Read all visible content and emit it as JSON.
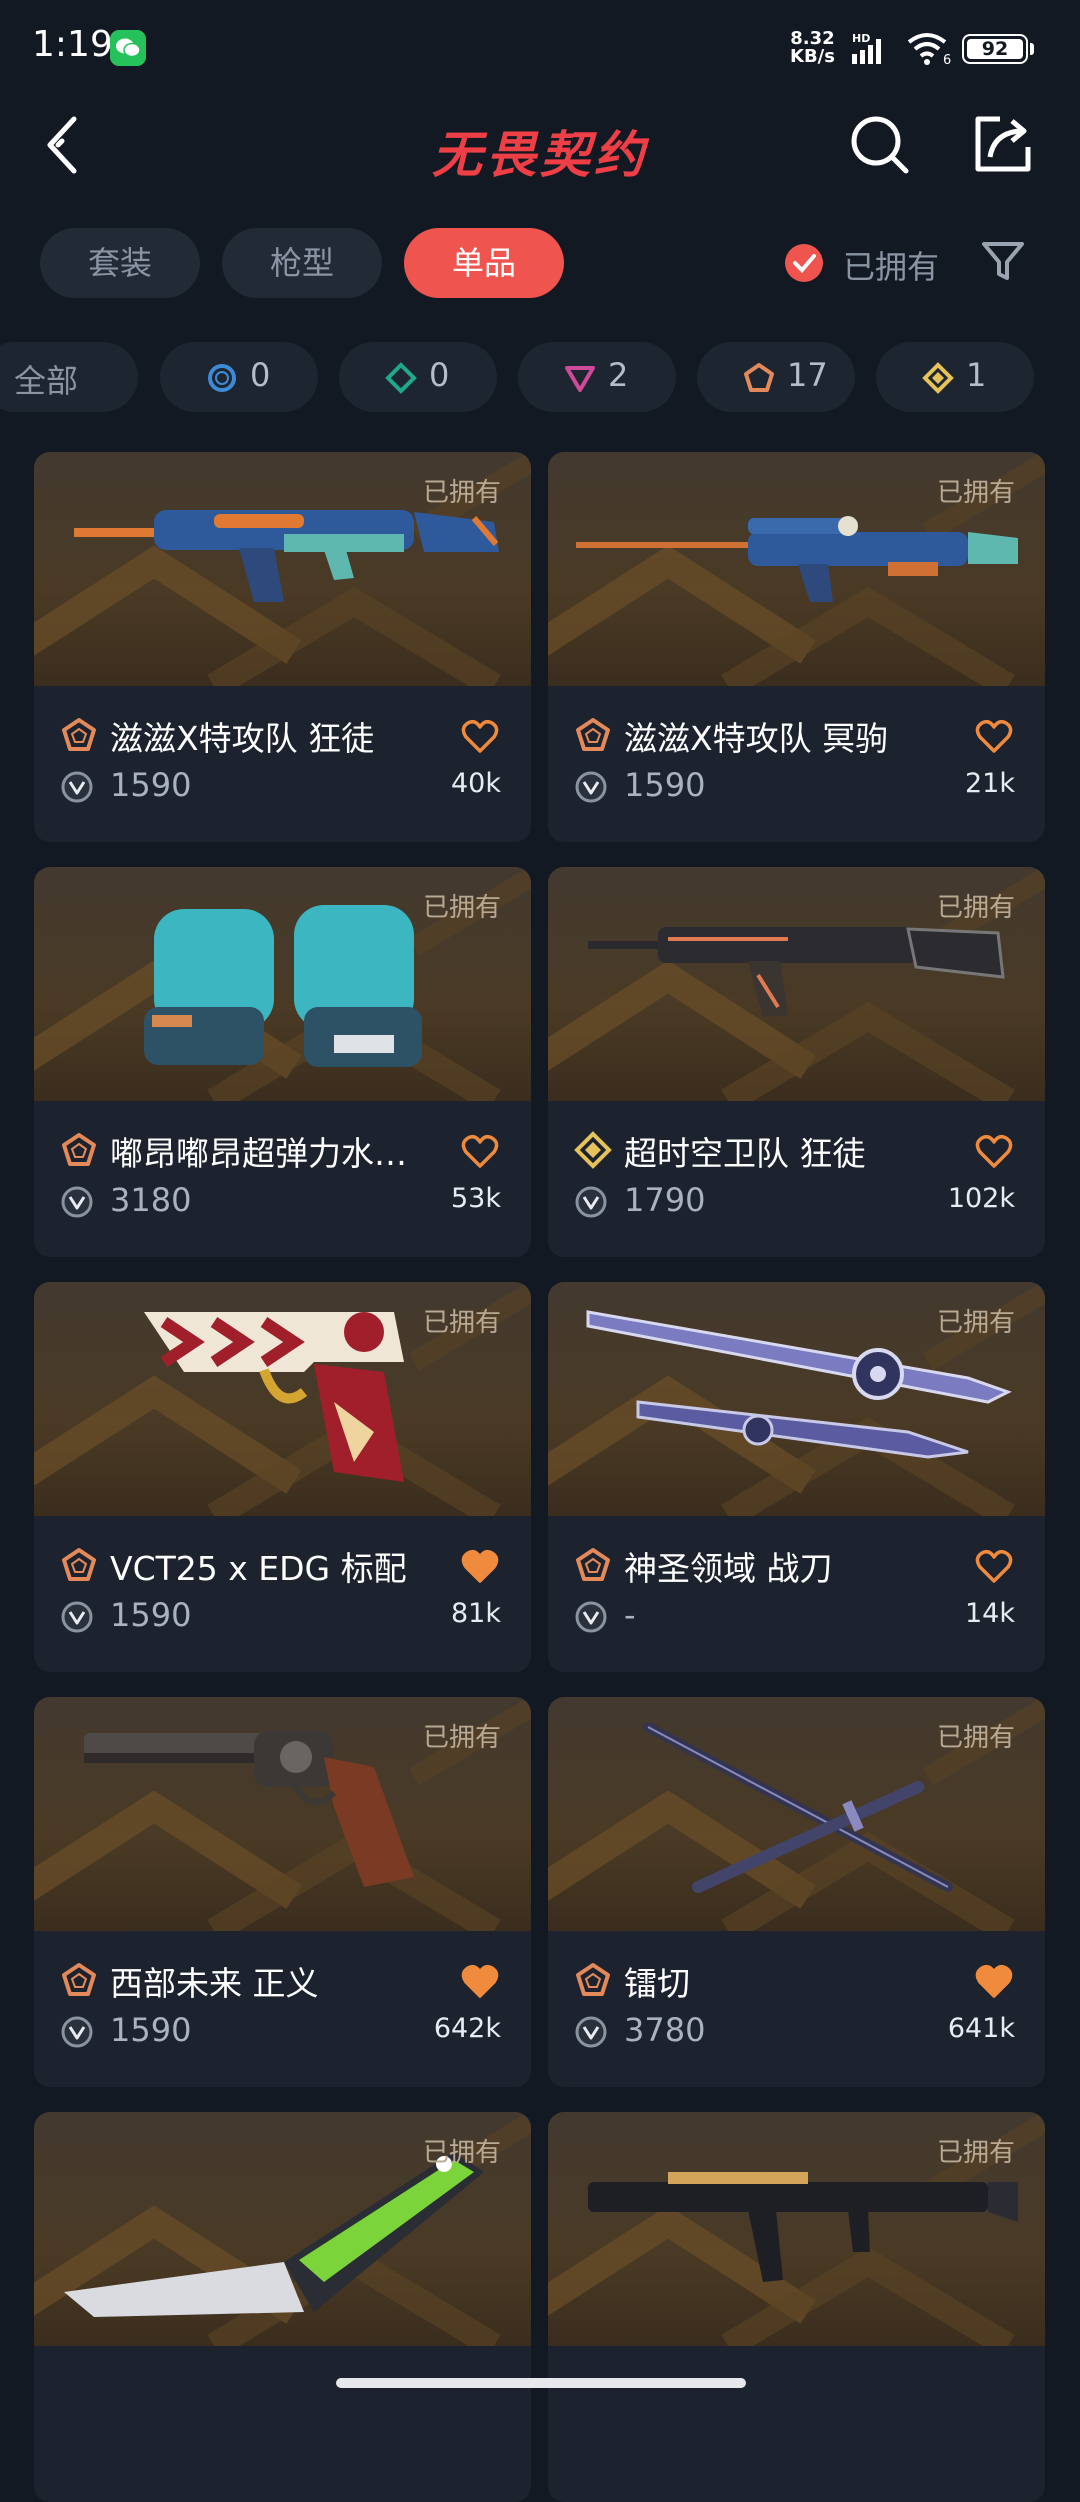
{
  "status_bar": {
    "time": "1:19",
    "net_speed_value": "8.32",
    "net_speed_unit": "KB/s",
    "signal_label": "HD",
    "wifi_label": "6",
    "battery": "92"
  },
  "nav": {
    "title": "无畏契约",
    "title_color": "#ee3f47"
  },
  "tabs": [
    {
      "label": "套装",
      "active": false
    },
    {
      "label": "枪型",
      "active": false
    },
    {
      "label": "单品",
      "active": true
    }
  ],
  "owned_filter": {
    "label": "已拥有",
    "checked": true
  },
  "rarity_chips": [
    {
      "label": "全部"
    },
    {
      "icon": "select-tier-icon",
      "count": "0",
      "color": "#3d8bd6"
    },
    {
      "icon": "deluxe-tier-icon",
      "count": "0",
      "color": "#1fa88c"
    },
    {
      "icon": "premium-tier-icon",
      "count": "2",
      "color": "#d04a9a"
    },
    {
      "icon": "ultra-tier-icon",
      "count": "17",
      "color": "#e3895a"
    },
    {
      "icon": "exclusive-tier-icon",
      "count": "1",
      "color": "#e6c35a"
    }
  ],
  "items": [
    {
      "name": "滋滋X特攻队 狂徒",
      "price": "1590",
      "likes": "40k",
      "owned": "已拥有",
      "tier": "ultra-tier-icon",
      "liked": false,
      "art": "rifle-blue"
    },
    {
      "name": "滋滋X特攻队 冥驹",
      "price": "1590",
      "likes": "21k",
      "owned": "已拥有",
      "tier": "ultra-tier-icon",
      "liked": false,
      "art": "sniper-blue"
    },
    {
      "name": "嘟昂嘟昂超弹力水…",
      "price": "3180",
      "likes": "53k",
      "owned": "已拥有",
      "tier": "ultra-tier-icon",
      "liked": false,
      "art": "gloves"
    },
    {
      "name": "超时空卫队 狂徒",
      "price": "1790",
      "likes": "102k",
      "owned": "已拥有",
      "tier": "exclusive-tier-icon",
      "liked": false,
      "art": "rifle-dark"
    },
    {
      "name": "VCT25 x EDG 标配",
      "price": "1590",
      "likes": "81k",
      "owned": "已拥有",
      "tier": "ultra-tier-icon",
      "liked": true,
      "art": "pistol"
    },
    {
      "name": "神圣领域 战刀",
      "price": "-",
      "likes": "14k",
      "owned": "已拥有",
      "tier": "ultra-tier-icon",
      "liked": false,
      "art": "knife-purple"
    },
    {
      "name": "西部未来 正义",
      "price": "1590",
      "likes": "642k",
      "owned": "已拥有",
      "tier": "ultra-tier-icon",
      "liked": true,
      "art": "revolver"
    },
    {
      "name": "镭切",
      "price": "3780",
      "likes": "641k",
      "owned": "已拥有",
      "tier": "ultra-tier-icon",
      "liked": true,
      "art": "katana"
    },
    {
      "name": "",
      "price": "",
      "likes": "",
      "owned": "已拥有",
      "tier": "",
      "liked": false,
      "art": "knife-green"
    },
    {
      "name": "",
      "price": "",
      "likes": "",
      "owned": "已拥有",
      "tier": "",
      "liked": false,
      "art": "smg-dark"
    }
  ]
}
